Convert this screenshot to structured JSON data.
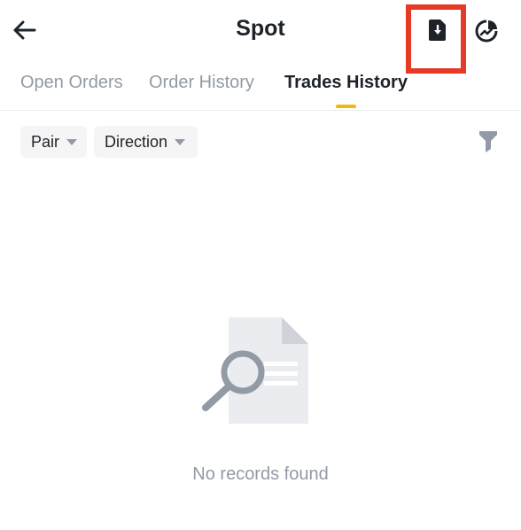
{
  "header": {
    "title": "Spot",
    "back_icon": "arrow-left-icon",
    "download_icon": "download-file-icon",
    "chart_icon": "pie-chart-icon",
    "highlight_color": "#e53a25"
  },
  "tabs": [
    {
      "label": "Open Orders",
      "active": false
    },
    {
      "label": "Order History",
      "active": false
    },
    {
      "label": "Trades History",
      "active": true
    }
  ],
  "filters": {
    "pair_label": "Pair",
    "direction_label": "Direction",
    "filter_icon": "funnel-icon"
  },
  "empty_state": {
    "icon": "document-search-icon",
    "message": "No records found"
  },
  "colors": {
    "accent": "#f0b90b",
    "text_primary": "#1e2329",
    "text_secondary": "#929aa5"
  }
}
